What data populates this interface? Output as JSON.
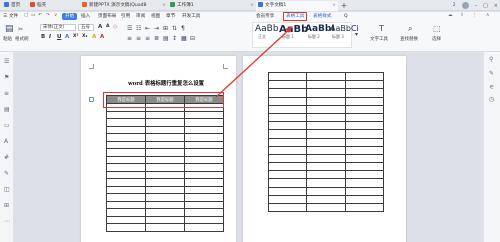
{
  "tabs": [
    {
      "label": "首页"
    },
    {
      "label": "稻壳"
    },
    {
      "label": "新建PPTX 演示文稿(Quad8"
    },
    {
      "label": "工作簿1"
    },
    {
      "label": "文字文稿1"
    }
  ],
  "window": {
    "count": "2"
  },
  "menu": {
    "file": "三 文件",
    "items": [
      "开始",
      "插入",
      "页面布局",
      "引用",
      "审阅",
      "视图",
      "章节",
      "开发工具",
      "会员专享"
    ],
    "table_tools": "表格工具",
    "table_style": "表格样式",
    "search": "Q"
  },
  "ribbon": {
    "paste": "粘贴",
    "format_painter": "格式刷",
    "font_name": "宋体(正文)",
    "font_size": "五号",
    "styles": [
      {
        "preview": "AaBb",
        "label": "正文"
      },
      {
        "preview": "AaBb",
        "label": "标题 1"
      },
      {
        "preview": "AaBbI",
        "label": "标题 2"
      },
      {
        "preview": "AaBbCi",
        "label": "标题 3"
      }
    ],
    "find_replace": "查找替换",
    "select": "选择",
    "text_tools": "文字工具"
  },
  "document": {
    "title": "word 表格标题行重复怎么设置",
    "table_headers": [
      "我是标题",
      "我是标题",
      "我是标题"
    ],
    "table1_rows": 17,
    "table2_rows": 17
  },
  "colors": {
    "accent": "#3f7ce3",
    "highlight": "#e2352b"
  }
}
